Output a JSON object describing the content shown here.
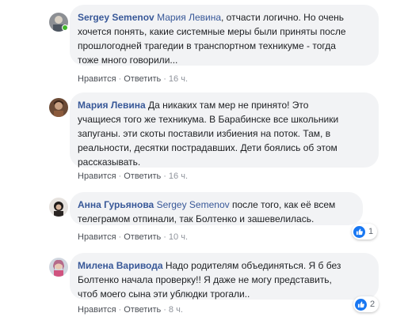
{
  "colors": {
    "author": "#385898",
    "bubble": "#f2f3f5",
    "meta": "#90949c",
    "like": "#1877f2"
  },
  "comments": [
    {
      "author": "Sergey Semenov",
      "mention": "Мария Левина",
      "lines": [
        ", отчасти логично. Но очень",
        "хочется понять, какие системные меры были приняты после",
        "прошлогодней трагедии в транспортном техникуме - тогда",
        "тоже много говорили..."
      ],
      "like_label": "Нравится",
      "reply_label": "Ответить",
      "time": "16 ч.",
      "avatar_icon": "avatar-photo-icon"
    },
    {
      "author": "Мария Левина",
      "mention": "",
      "lines": [
        " Да никаких там мер не принято! Это",
        "учащиеся того же техникума. В Барабинске все школьники",
        "запуганы. эти скоты поставили избиения на поток. Там, в",
        "реальности, десятки пострадавших. Дети боялись об этом",
        "рассказывать."
      ],
      "like_label": "Нравится",
      "reply_label": "Ответить",
      "time": "16 ч.",
      "avatar_icon": "avatar-photo-icon"
    },
    {
      "author": "Анна Гурьянова",
      "mention": "Sergey Semenov",
      "lines": [
        " после того, как её всем",
        "телеграмом отпинали, так Болтенко и зашевелилась."
      ],
      "like_label": "Нравится",
      "reply_label": "Ответить",
      "time": "10 ч.",
      "reactions": "1",
      "avatar_icon": "avatar-photo-icon"
    },
    {
      "author": "Милена Варивода",
      "mention": "",
      "lines": [
        " Надо родителям объединяться. Я б без",
        "Болтенко начала проверку!! Я даже не могу представить,",
        "чтоб моего сына эти ублюдки трогали.."
      ],
      "like_label": "Нравится",
      "reply_label": "Ответить",
      "time": "8 ч.",
      "reactions": "2",
      "avatar_icon": "avatar-photo-icon"
    }
  ]
}
